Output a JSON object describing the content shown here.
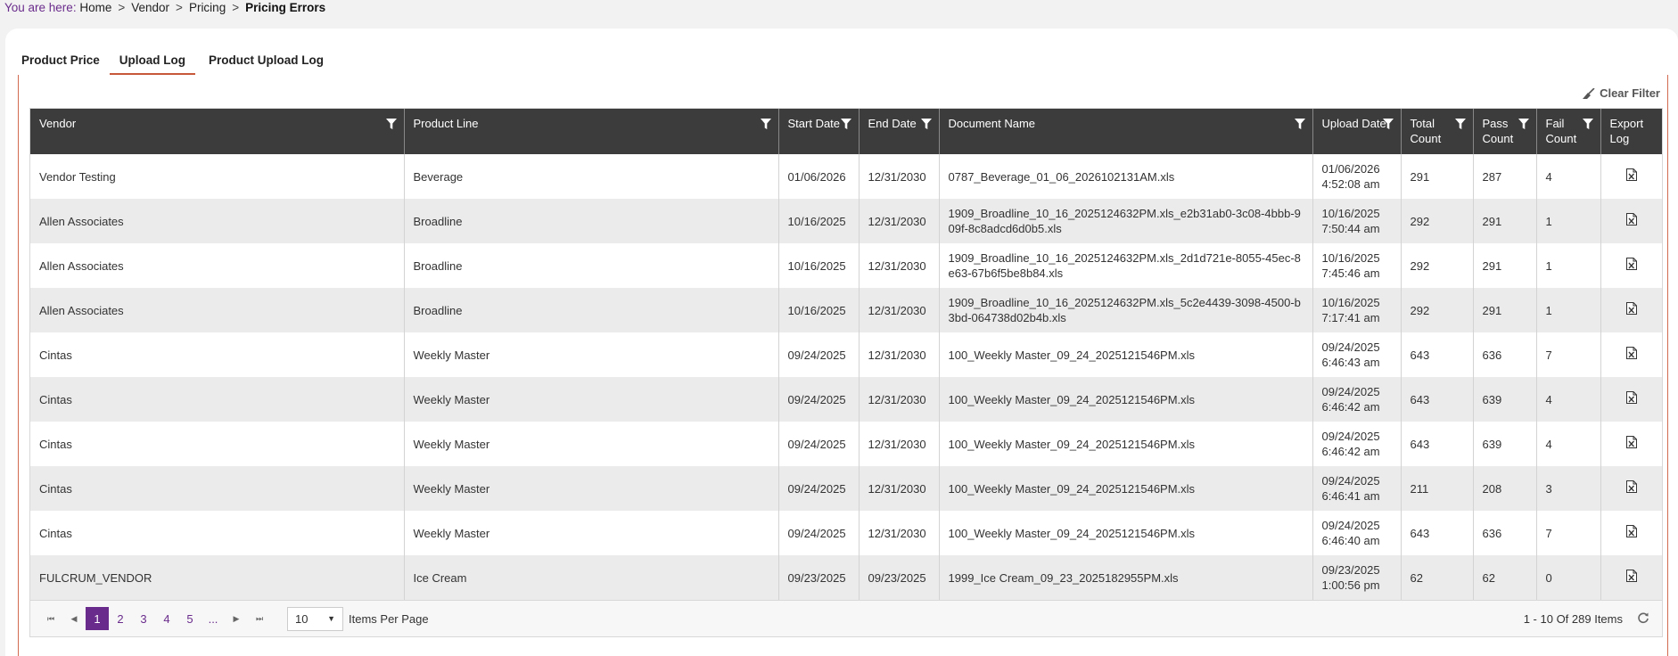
{
  "breadcrumb": {
    "prefix": "You are here:",
    "items": [
      "Home",
      "Vendor",
      "Pricing",
      "Pricing Errors"
    ],
    "separator": ">"
  },
  "tabs": [
    "Product Price",
    "Upload Log",
    "Product Upload Log"
  ],
  "active_tab": "Upload Log",
  "toolbar": {
    "clear_filter": "Clear Filter"
  },
  "columns": [
    "Vendor",
    "Product Line",
    "Start Date",
    "End Date",
    "Document Name",
    "Upload Date",
    "Total Count",
    "Pass Count",
    "Fail Count",
    "Export Log"
  ],
  "rows": [
    {
      "vendor": "Vendor Testing",
      "product_line": "Beverage",
      "start": "01/06/2026",
      "end": "12/31/2030",
      "document": "0787_Beverage_01_06_2026102131AM.xls",
      "upload_date": "01/06/2026",
      "upload_time": "4:52:08 am",
      "total": "291",
      "pass": "287",
      "fail": "4"
    },
    {
      "vendor": "Allen Associates",
      "product_line": "Broadline",
      "start": "10/16/2025",
      "end": "12/31/2030",
      "document": "1909_Broadline_10_16_2025124632PM.xls_e2b31ab0-3c08-4bbb-909f-8c8adcd6d0b5.xls",
      "upload_date": "10/16/2025",
      "upload_time": "7:50:44 am",
      "total": "292",
      "pass": "291",
      "fail": "1"
    },
    {
      "vendor": "Allen Associates",
      "product_line": "Broadline",
      "start": "10/16/2025",
      "end": "12/31/2030",
      "document": "1909_Broadline_10_16_2025124632PM.xls_2d1d721e-8055-45ec-8e63-67b6f5be8b84.xls",
      "upload_date": "10/16/2025",
      "upload_time": "7:45:46 am",
      "total": "292",
      "pass": "291",
      "fail": "1"
    },
    {
      "vendor": "Allen Associates",
      "product_line": "Broadline",
      "start": "10/16/2025",
      "end": "12/31/2030",
      "document": "1909_Broadline_10_16_2025124632PM.xls_5c2e4439-3098-4500-b3bd-064738d02b4b.xls",
      "upload_date": "10/16/2025",
      "upload_time": "7:17:41 am",
      "total": "292",
      "pass": "291",
      "fail": "1"
    },
    {
      "vendor": "Cintas",
      "product_line": "Weekly Master",
      "start": "09/24/2025",
      "end": "12/31/2030",
      "document": "100_Weekly Master_09_24_2025121546PM.xls",
      "upload_date": "09/24/2025",
      "upload_time": "6:46:43 am",
      "total": "643",
      "pass": "636",
      "fail": "7"
    },
    {
      "vendor": "Cintas",
      "product_line": "Weekly Master",
      "start": "09/24/2025",
      "end": "12/31/2030",
      "document": "100_Weekly Master_09_24_2025121546PM.xls",
      "upload_date": "09/24/2025",
      "upload_time": "6:46:42 am",
      "total": "643",
      "pass": "639",
      "fail": "4"
    },
    {
      "vendor": "Cintas",
      "product_line": "Weekly Master",
      "start": "09/24/2025",
      "end": "12/31/2030",
      "document": "100_Weekly Master_09_24_2025121546PM.xls",
      "upload_date": "09/24/2025",
      "upload_time": "6:46:42 am",
      "total": "643",
      "pass": "639",
      "fail": "4"
    },
    {
      "vendor": "Cintas",
      "product_line": "Weekly Master",
      "start": "09/24/2025",
      "end": "12/31/2030",
      "document": "100_Weekly Master_09_24_2025121546PM.xls",
      "upload_date": "09/24/2025",
      "upload_time": "6:46:41 am",
      "total": "211",
      "pass": "208",
      "fail": "3"
    },
    {
      "vendor": "Cintas",
      "product_line": "Weekly Master",
      "start": "09/24/2025",
      "end": "12/31/2030",
      "document": "100_Weekly Master_09_24_2025121546PM.xls",
      "upload_date": "09/24/2025",
      "upload_time": "6:46:40 am",
      "total": "643",
      "pass": "636",
      "fail": "7"
    },
    {
      "vendor": "FULCRUM_VENDOR",
      "product_line": "Ice Cream",
      "start": "09/23/2025",
      "end": "09/23/2025",
      "document": "1999_Ice Cream_09_23_2025182955PM.xls",
      "upload_date": "09/23/2025",
      "upload_time": "1:00:56 pm",
      "total": "62",
      "pass": "62",
      "fail": "0"
    }
  ],
  "pager": {
    "pages": [
      "1",
      "2",
      "3",
      "4",
      "5",
      "..."
    ],
    "current_page": "1",
    "page_size": "10",
    "page_size_label": "Items Per Page",
    "summary": "1 - 10 Of 289 Items"
  },
  "colors": {
    "accent": "#6a2c8c",
    "header_bg": "#3c3c3c",
    "panel_border": "#d26a4f"
  }
}
